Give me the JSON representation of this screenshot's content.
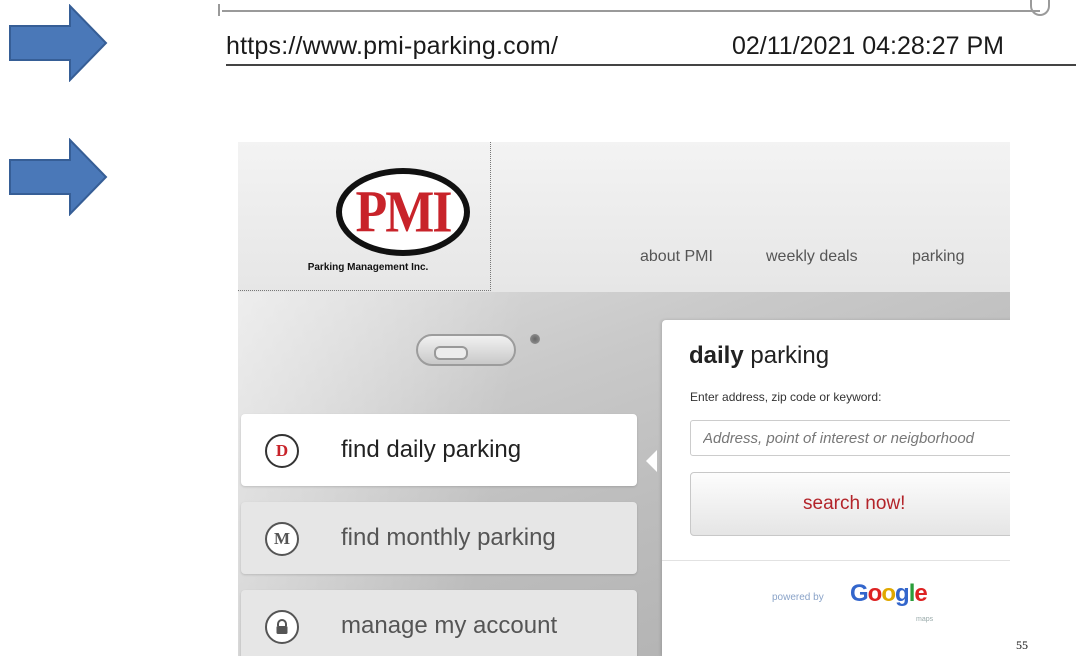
{
  "capture": {
    "url": "https://www.pmi-parking.com/",
    "timestamp": "02/11/2021 04:28:27 PM"
  },
  "arrows": {
    "icon": "right-arrow-icon",
    "color": "#4a78b8"
  },
  "site": {
    "logo": {
      "mark": "PMI",
      "tagline": "Parking Management Inc.",
      "brand_color": "#c8232a"
    },
    "nav": [
      {
        "label": "about PMI"
      },
      {
        "label": "weekly deals"
      },
      {
        "label": "parking"
      }
    ],
    "menu": [
      {
        "badge": "D",
        "label": "find daily parking",
        "active": true
      },
      {
        "badge": "M",
        "label": "find monthly parking",
        "active": false
      },
      {
        "badge_icon": "lock-icon",
        "label": "manage my account",
        "active": false
      }
    ],
    "search": {
      "title_bold": "daily",
      "title_rest": " parking",
      "hint": "Enter address, zip code or keyword:",
      "placeholder": "Address, point of interest or neigborhood",
      "button_label": "search now!",
      "powered_by": "powered by",
      "google_letters": [
        "G",
        "o",
        "o",
        "g",
        "l",
        "e"
      ],
      "maps_label": "maps"
    }
  },
  "page_number": "55"
}
